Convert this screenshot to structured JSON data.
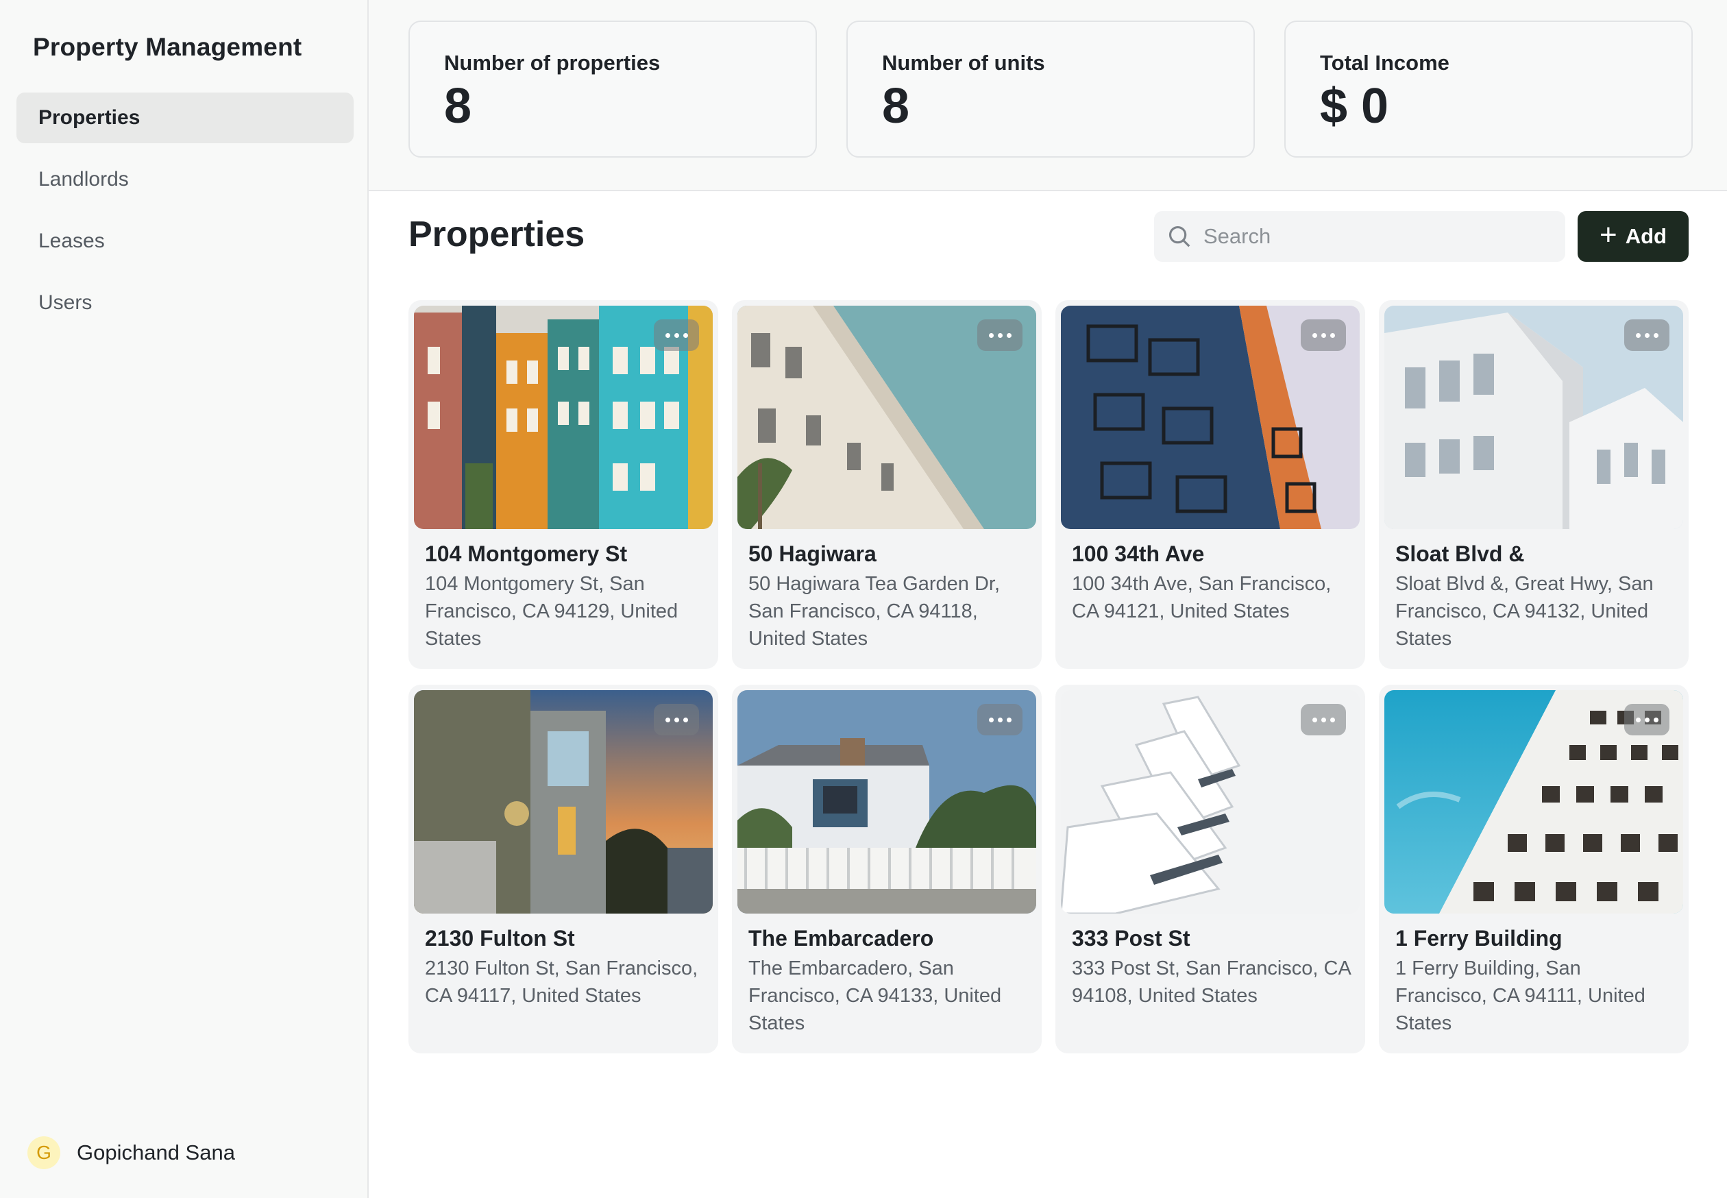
{
  "app": {
    "title": "Property Management"
  },
  "sidebar": {
    "items": [
      {
        "label": "Properties",
        "active": true
      },
      {
        "label": "Landlords",
        "active": false
      },
      {
        "label": "Leases",
        "active": false
      },
      {
        "label": "Users",
        "active": false
      }
    ]
  },
  "user": {
    "initial": "G",
    "name": "Gopichand Sana"
  },
  "stats": [
    {
      "label": "Number of properties",
      "value": "8"
    },
    {
      "label": "Number of units",
      "value": "8"
    },
    {
      "label": "Total Income",
      "value": "$ 0"
    }
  ],
  "main": {
    "title": "Properties",
    "search_placeholder": "Search",
    "add_label": "Add"
  },
  "properties": [
    {
      "name": "104 Montgomery St",
      "address": "104 Montgomery St, San Francisco, CA 94129, United States"
    },
    {
      "name": "50 Hagiwara",
      "address": "50 Hagiwara Tea Garden Dr, San Francisco, CA 94118, United States"
    },
    {
      "name": "100 34th Ave",
      "address": "100 34th Ave, San Francisco, CA 94121, United States"
    },
    {
      "name": "Sloat Blvd &",
      "address": "Sloat Blvd &, Great Hwy, San Francisco, CA 94132, United States"
    },
    {
      "name": "2130 Fulton St",
      "address": "2130 Fulton St, San Francisco, CA 94117, United States"
    },
    {
      "name": "The Embarcadero",
      "address": "The Embarcadero, San Francisco, CA 94133, United States"
    },
    {
      "name": "333 Post St",
      "address": "333 Post St, San Francisco, CA 94108, United States"
    },
    {
      "name": "1 Ferry Building",
      "address": "1 Ferry Building, San Francisco, CA 94111, United States"
    }
  ],
  "colors": {
    "accent": "#1d2a21",
    "active_nav": "#e8e9e8",
    "avatar_bg": "#fdf4bd"
  }
}
